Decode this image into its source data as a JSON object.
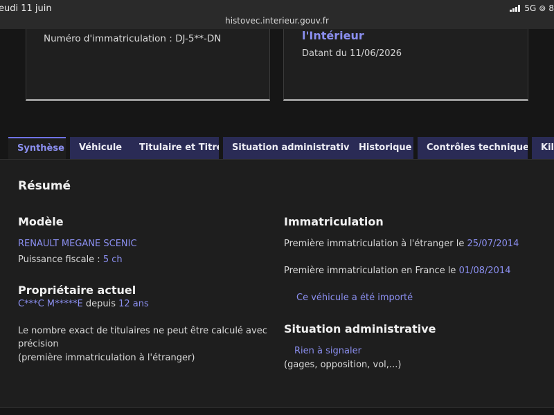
{
  "status_bar": {
    "time": "eudi 11 juin",
    "url": "histovec.interieur.gouv.fr",
    "network": "5G",
    "battery": "8"
  },
  "cards": {
    "plate_line": "Numéro d'immatriculation : DJ-5**-DN",
    "issuer": "l'Intérieur",
    "date_line": "Datant du 11/06/2026"
  },
  "tabs": [
    {
      "label": "Synthèse",
      "active": true
    },
    {
      "label": "Véhicule",
      "active": false
    },
    {
      "label": "Titulaire et Titre",
      "active": false
    },
    {
      "label": "Situation administrative",
      "active": false
    },
    {
      "label": "Historique",
      "active": false
    },
    {
      "label": "Contrôles techniques",
      "active": false
    },
    {
      "label": "Kilo",
      "active": false
    }
  ],
  "summary": {
    "title": "Résumé",
    "model": {
      "heading": "Modèle",
      "value": "RENAULT MEGANE SCENIC",
      "fiscal_label": "Puissance fiscale : ",
      "fiscal_value": "5 ch"
    },
    "owner": {
      "heading": "Propriétaire actuel",
      "name": "C***C M*****E",
      "since_label": " depuis ",
      "since_value": "12 ans",
      "note_line1": "Le nombre exact de titulaires ne peut être calculé avec",
      "note_line2": "précision",
      "note_line3": "(première immatriculation à l'étranger)"
    },
    "registration": {
      "heading": "Immatriculation",
      "foreign_label": "Première immatriculation à l'étranger le ",
      "foreign_date": "25/07/2014",
      "france_label": "Première immatriculation en France le ",
      "france_date": "01/08/2014",
      "imported": "Ce véhicule a été importé"
    },
    "admin": {
      "heading": "Situation administrative",
      "status": "Rien à signaler",
      "details": "(gages, opposition, vol,...)"
    }
  }
}
